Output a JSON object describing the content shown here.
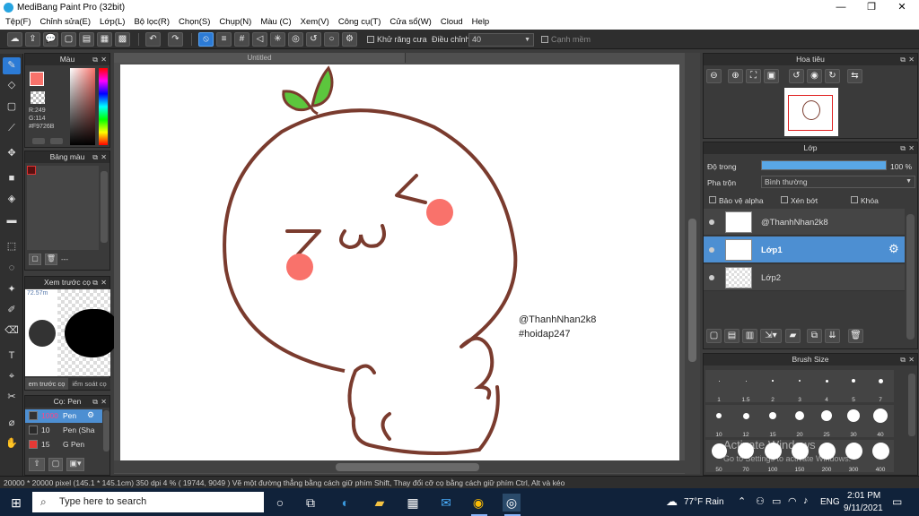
{
  "window": {
    "title": "MediBang Paint Pro (32bit)",
    "minimize": "—",
    "restore": "❐",
    "close": "✕"
  },
  "menu": [
    "Tệp(F)",
    "Chỉnh sửa(E)",
    "Lớp(L)",
    "Bộ lọc(R)",
    "Chọn(S)",
    "Chụp(N)",
    "Màu (C)",
    "Xem(V)",
    "Công cụ(T)",
    "Cửa sổ(W)",
    "Cloud",
    "Help"
  ],
  "toolbar": {
    "antialias_label": "Khử răng cưa",
    "adjust_label": "Điều chỉnh",
    "adjust_value": "40",
    "smooth_label": "Cạnh mềm"
  },
  "color_panel": {
    "title": "Màu",
    "r": "R:249",
    "g": "G:114",
    "hex": "#F9726B",
    "fg_color": "#F9726B"
  },
  "palette_panel": {
    "title": "Bảng màu",
    "footer": "---"
  },
  "brush_preview_panel": {
    "title": "Xem trước cọ",
    "zoom": "72.57m",
    "tab1": "em trước cọ",
    "tab2": "iểm soát cọ"
  },
  "brush_list_panel": {
    "title": "Cọ: Pen",
    "items": [
      {
        "size": "1000",
        "name": "Pen",
        "color": "#333333"
      },
      {
        "size": "10",
        "name": "Pen (Sha",
        "color": "#2a2a2a"
      },
      {
        "size": "15",
        "name": "G Pen",
        "color": "#e53935"
      }
    ]
  },
  "document": {
    "tab": "Untitled",
    "signature_line1": "@ThanhNhan2k8",
    "signature_line2": "#hoidap247"
  },
  "status": "20000 * 20000 pixel   (145.1 * 145.1cm)   350 dpi   4 %   ( 19744, 9049 )   Vẽ một đường thẳng bằng cách giữ phím Shift, Thay đổi cỡ cọ bằng cách giữ phím Ctrl, Alt và kéo",
  "navigator_panel": {
    "title": "Hoa tiêu"
  },
  "layer_panel": {
    "title": "Lớp",
    "opacity_label": "Độ trong",
    "opacity_value": "100 %",
    "opacity_fraction": 1.0,
    "blend_label": "Pha trộn",
    "blend_value": "Bình thường",
    "protect_alpha": "Bảo vệ alpha",
    "clipping": "Xén bớt",
    "lock": "Khóa",
    "layers": [
      {
        "name": "@ThanhNhan2k8",
        "selected": false
      },
      {
        "name": "Lớp1",
        "selected": true
      },
      {
        "name": "Lớp2",
        "selected": false
      }
    ]
  },
  "brush_size_panel": {
    "title": "Brush Size",
    "row1": [
      "1",
      "1.5",
      "2",
      "3",
      "4",
      "5",
      "7"
    ],
    "row2": [
      "10",
      "12",
      "15",
      "20",
      "25",
      "30",
      "40"
    ],
    "row3": [
      "50",
      "70",
      "100",
      "150",
      "200",
      "300",
      "400"
    ]
  },
  "watermark": {
    "line1": "Activate Windows",
    "line2": "Go to Settings to activate Windows."
  },
  "taskbar": {
    "search_placeholder": "Type here to search",
    "weather": "77°F  Rain",
    "lang": "ENG",
    "time": "2:01 PM",
    "date": "9/11/2021"
  }
}
